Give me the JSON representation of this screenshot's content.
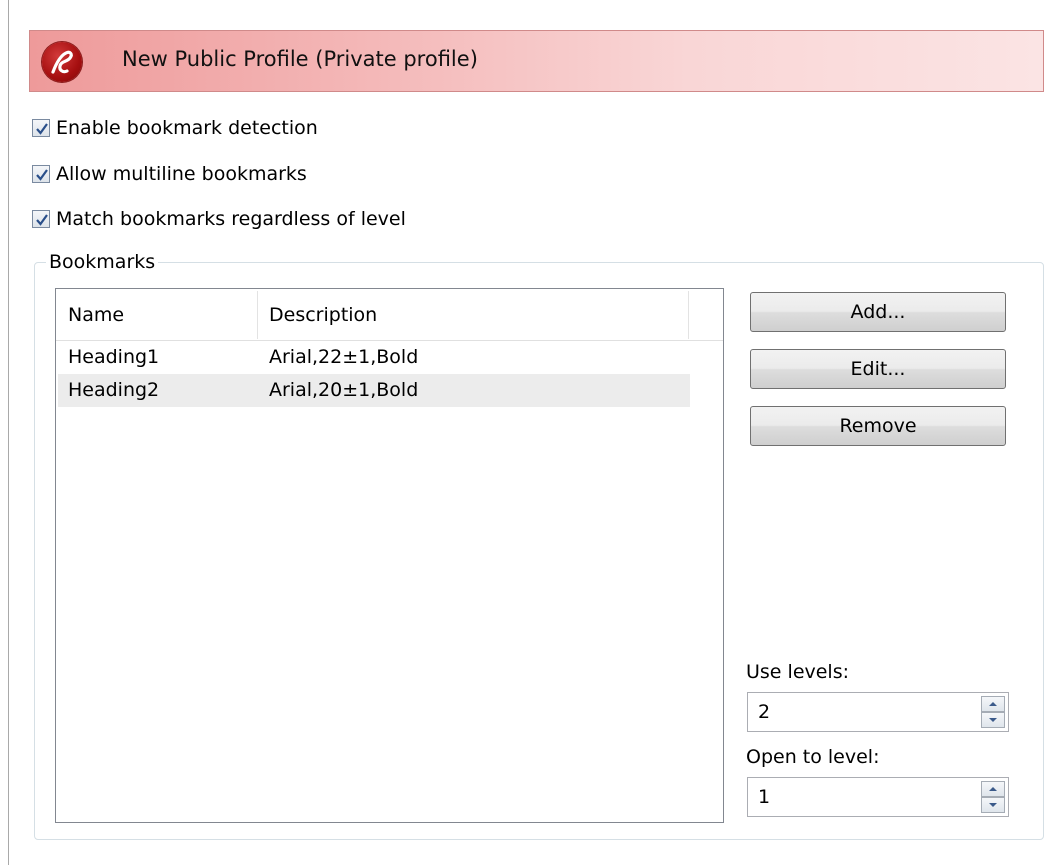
{
  "banner": {
    "title": "New Public Profile (Private profile)"
  },
  "options": [
    {
      "label": "Enable bookmark detection",
      "checked": true
    },
    {
      "label": "Allow multiline bookmarks",
      "checked": true
    },
    {
      "label": "Match bookmarks regardless of level",
      "checked": true
    }
  ],
  "bookmarks": {
    "group_label": "Bookmarks",
    "columns": {
      "name": "Name",
      "description": "Description"
    },
    "rows": [
      {
        "name": "Heading1",
        "description": "Arial,22±1,Bold"
      },
      {
        "name": "Heading2",
        "description": "Arial,20±1,Bold"
      }
    ],
    "buttons": {
      "add": "Add...",
      "edit": "Edit...",
      "remove": "Remove"
    },
    "use_levels": {
      "label": "Use levels:",
      "value": "2"
    },
    "open_to_level": {
      "label": "Open to level:",
      "value": "1"
    }
  },
  "icons": {
    "logo": "app-logo-icon",
    "checkmark": "checkmark-icon",
    "spin_up": "spin-up-arrow-icon",
    "spin_down": "spin-down-arrow-icon"
  },
  "colors": {
    "banner_start": "#ee9a9a",
    "banner_end": "#fbe4e4",
    "logo_red": "#a60f10",
    "checkmark_blue": "#2a4f8a",
    "selected_row": "#ececec"
  }
}
